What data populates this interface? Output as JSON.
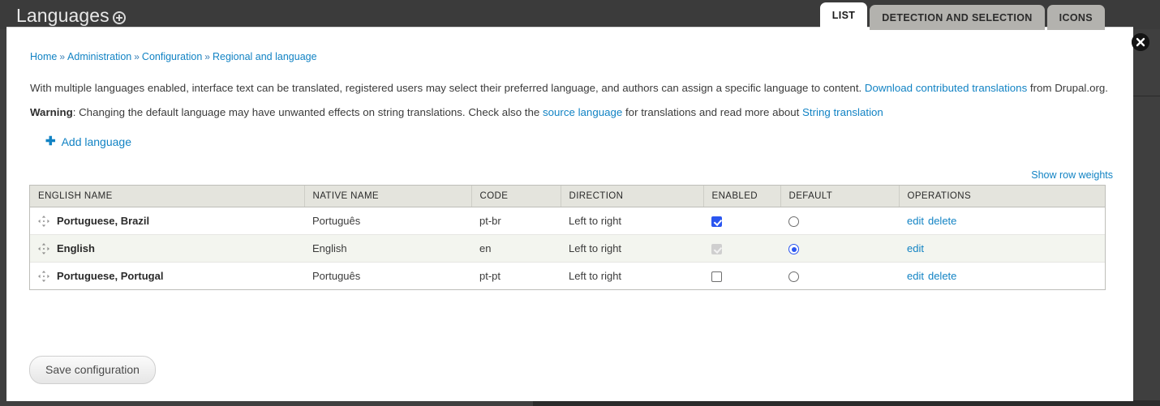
{
  "chrome": {
    "page_title": "Languages",
    "title_badge_icon": "plus-circle-icon"
  },
  "tabs": [
    {
      "label": "LIST",
      "active": true
    },
    {
      "label": "DETECTION AND SELECTION",
      "active": false
    },
    {
      "label": "ICONS",
      "active": false
    }
  ],
  "close_button": {
    "icon": "close-circle-icon",
    "label": ""
  },
  "breadcrumb": {
    "items": [
      "Home",
      "Administration",
      "Configuration",
      "Regional and language"
    ],
    "separator": "»"
  },
  "intro": {
    "text_before_link": "With multiple languages enabled, interface text can be translated, registered users may select their preferred language, and authors can assign a specific language to content. ",
    "link_label": "Download contributed translations",
    "text_after_link": " from Drupal.org."
  },
  "warning": {
    "label": "Warning",
    "text_1": ": Changing the default language may have unwanted effects on string translations. Check also the ",
    "link_1": "source language",
    "text_2": " for translations and read more about ",
    "link_2": "String translation"
  },
  "actions": {
    "add_language_label": "Add language",
    "add_language_icon": "plus-icon",
    "show_row_weights_label": "Show row weights",
    "save_label": "Save configuration"
  },
  "table": {
    "headers": [
      "ENGLISH NAME",
      "NATIVE NAME",
      "CODE",
      "DIRECTION",
      "ENABLED",
      "DEFAULT",
      "OPERATIONS"
    ],
    "rows": [
      {
        "drag_icon": "drag-handle-icon",
        "english_name": "Portuguese, Brazil",
        "native_name": "Português",
        "code": "pt-br",
        "direction": "Left to right",
        "enabled": true,
        "enabled_disabled": false,
        "is_default": false,
        "operations": [
          "edit",
          "delete"
        ]
      },
      {
        "drag_icon": "drag-handle-icon",
        "english_name": "English",
        "native_name": "English",
        "code": "en",
        "direction": "Left to right",
        "enabled": true,
        "enabled_disabled": true,
        "is_default": true,
        "operations": [
          "edit"
        ]
      },
      {
        "drag_icon": "drag-handle-icon",
        "english_name": "Portuguese, Portugal",
        "native_name": "Português",
        "code": "pt-pt",
        "direction": "Left to right",
        "enabled": false,
        "enabled_disabled": false,
        "is_default": false,
        "operations": [
          "edit",
          "delete"
        ]
      }
    ]
  },
  "colors": {
    "link": "#1283c4",
    "accent_checked": "#2b56f0",
    "header_bg": "#e4e4dd",
    "chrome_bg": "#3b3b3b",
    "row_alt_bg": "#f3f5ef"
  }
}
